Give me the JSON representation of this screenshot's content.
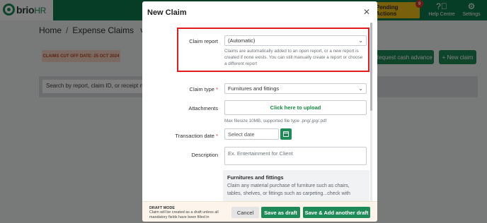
{
  "app": {
    "logo_text": "brio",
    "logo_suffix": "HR",
    "pending_label": "Pending Actions",
    "pending_count": "9",
    "help_label": "Help Centre",
    "settings_label": "Settings",
    "help_icon": "question-circle-icon",
    "settings_icon": "gear-icon"
  },
  "breadcrumb": {
    "home": "Home",
    "separator": "/",
    "current": "Expense Claims",
    "caret": "∨"
  },
  "page": {
    "cutoff": "CLAIMS CUT OFF DATE: 25 OCT 2024",
    "request_cash_advance": "Request cash advance",
    "new_claim": "+ New claim",
    "search_placeholder": "Search by report, claim ID, or receipt number"
  },
  "modal": {
    "title": "New Claim",
    "close": "✕",
    "claim_report": {
      "label": "Claim report",
      "value": "(Automatic)",
      "hint": "Claims are automatically added to an open report, or a new report is created if none exists. You can still manually create a report or choose a different report"
    },
    "claim_type": {
      "label": "Claim type",
      "required_mark": "*",
      "value": "Furnitures and fittings"
    },
    "attachments": {
      "label": "Attachments",
      "upload": "Click here to upload",
      "hint": "Max filesize 10MB, supported file type .png/.jpg/.pdf"
    },
    "transaction_date": {
      "label": "Transaction date",
      "required_mark": "*",
      "placeholder": "Select date"
    },
    "description": {
      "label": "Description",
      "placeholder": "Ex. Entertainment for Client"
    },
    "category_info": {
      "title": "Furnitures and fittings",
      "description": "Claim any material purchase of furniture such as chairs, tables, shelves, or fittings such as carpeting...check with"
    },
    "footer": {
      "draft_title": "DRAFT MODE",
      "draft_desc": "Claim will be created as a draft unless all mandatory fields have been filled in",
      "cancel": "Cancel",
      "save_draft": "Save as draft",
      "save_add": "Save & Add another draft"
    }
  },
  "colors": {
    "brand_green": "#1e8a57",
    "topbar": "#0d7a4c",
    "pending": "#f3c11b",
    "highlight": "#e01c1c"
  }
}
